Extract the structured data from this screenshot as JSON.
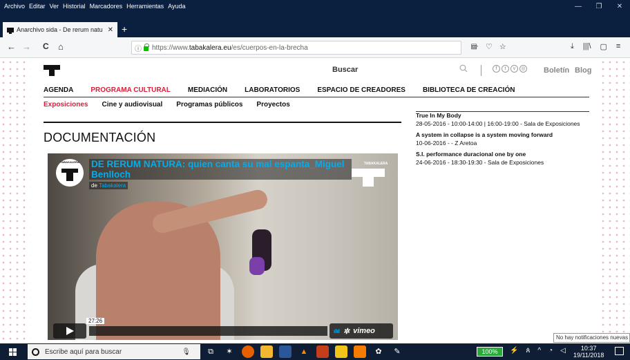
{
  "menubar": {
    "items": [
      "Archivo",
      "Editar",
      "Ver",
      "Historial",
      "Marcadores",
      "Herramientas",
      "Ayuda"
    ]
  },
  "window_controls": {
    "minimize": "—",
    "restore": "❐",
    "close": "✕"
  },
  "tab": {
    "title": "Anarchivo sida - De rerum natu",
    "close": "✕",
    "new_tab": "+"
  },
  "navbar": {
    "back": "←",
    "forward": "→",
    "reload": "C",
    "home": "⌂",
    "url_prefix": "https://www.",
    "url_host": "tabakalera.eu",
    "url_path": "/es/cuerpos-en-la-brecha",
    "reader": "▤",
    "more": "···",
    "pocket": "♡",
    "bookmark": "☆",
    "download": "⤓",
    "library": "|||\\",
    "sidebar": "▢",
    "menu": "≡"
  },
  "site": {
    "search_label": "Buscar",
    "top_links": {
      "boletin": "Boletín",
      "blog": "Blog"
    },
    "social": [
      "f",
      "t",
      "v",
      "◎"
    ],
    "main_nav": [
      {
        "label": "AGENDA",
        "active": false
      },
      {
        "label": "PROGRAMA CULTURAL",
        "active": true
      },
      {
        "label": "MEDIACIÓN",
        "active": false
      },
      {
        "label": "LABORATORIOS",
        "active": false
      },
      {
        "label": "ESPACIO DE CREADORES",
        "active": false
      },
      {
        "label": "BIBLIOTECA DE CREACIÓN",
        "active": false
      }
    ],
    "sub_nav": [
      {
        "label": "Exposiciones",
        "active": true
      },
      {
        "label": "Cine y audiovisual",
        "active": false
      },
      {
        "label": "Programas públicos",
        "active": false
      },
      {
        "label": "Proyectos",
        "active": false
      }
    ],
    "section_title": "DOCUMENTACIÓN"
  },
  "video": {
    "logo_text": "TABAKALERA",
    "title": "DE RERUM NATURA: quien canta su mal espanta_Miguel Benlloch",
    "by_prefix": "de",
    "channel": "Tabakalera",
    "overlay_text": "TABAKALERA",
    "time": "27:26",
    "brand": "vimeo",
    "settings_icon": "✲",
    "signal": "ılıl"
  },
  "events": [
    {
      "title": "True In My Body",
      "detail": "28-05-2016 - 10:00-14:00 | 16:00-19:00 - Sala de Exposiciones"
    },
    {
      "title": "A system in collapse is a system moving forward",
      "detail": "10-06-2016 - - Z Aretoa"
    },
    {
      "title": "S.I. performance duracional one by one",
      "detail": "24-06-2016 - 18:30-19:30 - Sala de Exposiciones"
    }
  ],
  "notification": "No hay notificaciones nuevas",
  "taskbar": {
    "search_placeholder": "Escribe aquí para buscar",
    "battery": "100%",
    "time": "10:37",
    "date": "19/11/2018"
  },
  "colors": {
    "accent_red": "#d5213a",
    "vimeo_blue": "#00adef",
    "titlebar": "#0b1f3f",
    "taskbar": "#0f1e35"
  }
}
